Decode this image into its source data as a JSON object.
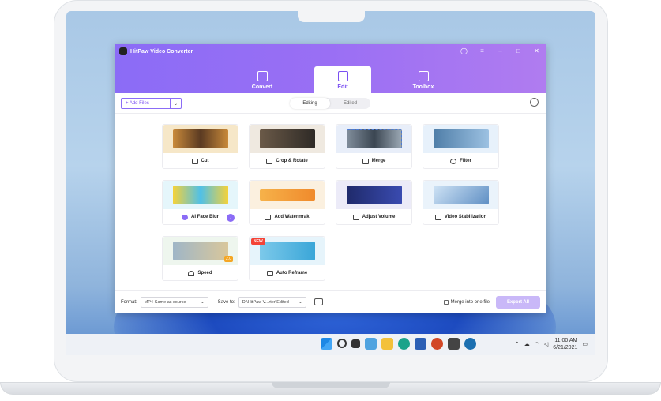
{
  "app": {
    "title": "HitPaw Video Converter",
    "window_controls": [
      "◯",
      "≡",
      "–",
      "□",
      "✕"
    ]
  },
  "main_tabs": [
    {
      "label": "Convert",
      "active": false
    },
    {
      "label": "Edit",
      "active": true
    },
    {
      "label": "Toolbox",
      "active": false
    }
  ],
  "toolbar": {
    "add_files_label": "+ Add Files",
    "add_files_dropdown": "⌄",
    "segments": [
      "Editing",
      "Edited"
    ],
    "active_segment": "Editing"
  },
  "tools": [
    {
      "label": "Cut",
      "icon": "cut-icon",
      "color": "#f6e7c8"
    },
    {
      "label": "Crop & Rotate",
      "icon": "crop-icon",
      "color": "#efe9e0"
    },
    {
      "label": "Merge",
      "icon": "merge-icon",
      "color": "#e8eef9"
    },
    {
      "label": "Filter",
      "icon": "filter-icon",
      "color": "#e7f1fb"
    },
    {
      "label": "AI Face Blur",
      "icon": "face-blur-icon",
      "color": "#e5f6fb"
    },
    {
      "label": "Add Watermrak",
      "icon": "watermark-icon",
      "color": "#fbf0df"
    },
    {
      "label": "Adjust Volume",
      "icon": "volume-icon",
      "color": "#ecebf8"
    },
    {
      "label": "Video Stabilization",
      "icon": "stabilization-icon",
      "color": "#eaf3fb"
    },
    {
      "label": "Speed",
      "icon": "speed-icon",
      "color": "#eef6ee"
    },
    {
      "label": "Auto Reframe",
      "icon": "reframe-icon",
      "color": "#e6f4fb"
    }
  ],
  "badges": {
    "new": "NEW",
    "speed": "2.0"
  },
  "footer": {
    "format_label": "Format:",
    "format_value": "MP4-Same as source",
    "save_label": "Save to:",
    "save_value": "D:\\HitPaw V...rter\\Edited",
    "merge_label": "Merge into one file",
    "export_label": "Export All"
  },
  "taskbar": {
    "time": "11:00 AM",
    "date": "6/21/2021"
  }
}
